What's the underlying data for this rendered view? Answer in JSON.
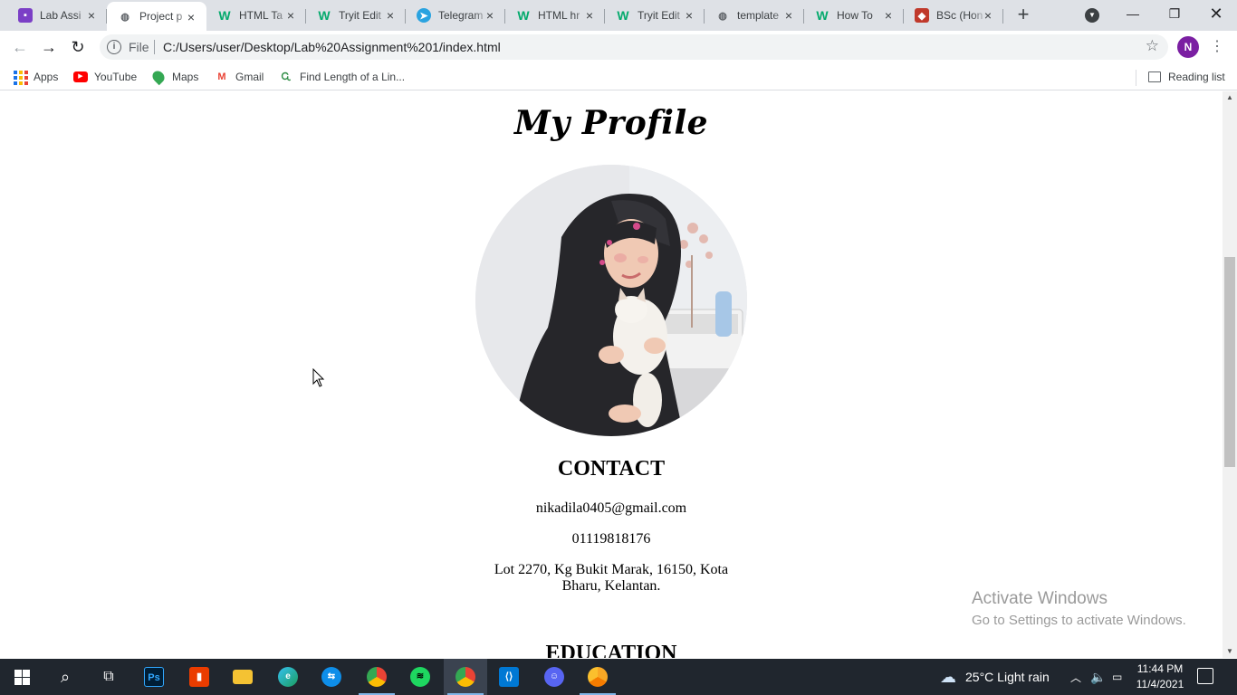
{
  "browser": {
    "tabs": [
      {
        "title": "Lab Assi",
        "icon": "classroom-icon"
      },
      {
        "title": "Project p",
        "icon": "globe-icon"
      },
      {
        "title": "HTML Ta",
        "icon": "w3schools-icon"
      },
      {
        "title": "Tryit Edit",
        "icon": "w3schools-icon"
      },
      {
        "title": "Telegram",
        "icon": "telegram-icon"
      },
      {
        "title": "HTML hr",
        "icon": "w3schools-icon"
      },
      {
        "title": "Tryit Edit",
        "icon": "w3schools-icon"
      },
      {
        "title": "template",
        "icon": "globe-icon"
      },
      {
        "title": "How To",
        "icon": "w3schools-icon"
      },
      {
        "title": "BSc (Hon",
        "icon": "university-icon"
      }
    ],
    "active_tab_index": 1,
    "address_bar": {
      "scheme": "File",
      "url": "C:/Users/user/Desktop/Lab%20Assignment%201/index.html"
    },
    "profile_initial": "N",
    "bookmarks": [
      {
        "label": "Apps",
        "icon": "apps-grid-icon"
      },
      {
        "label": "YouTube",
        "icon": "youtube-icon"
      },
      {
        "label": "Maps",
        "icon": "maps-icon"
      },
      {
        "label": "Gmail",
        "icon": "gmail-icon"
      },
      {
        "label": "Find Length of a Lin...",
        "icon": "geeksforgeeks-icon"
      }
    ],
    "reading_list_label": "Reading list"
  },
  "page": {
    "title": "My Profile",
    "profile_photo_alt": "profile photo",
    "contact": {
      "heading": "CONTACT",
      "email": "nikadila0405@gmail.com",
      "phone": "01119818176",
      "address": "Lot 2270, Kg Bukit Marak, 16150, Kota Bharu, Kelantan."
    },
    "education_heading": "EDUCATION"
  },
  "watermark": {
    "line1": "Activate Windows",
    "line2": "Go to Settings to activate Windows."
  },
  "taskbar": {
    "apps": [
      "start-icon",
      "search-icon",
      "task-view-icon",
      "photoshop-icon",
      "office-icon",
      "file-explorer-icon",
      "edge-icon",
      "teamviewer-icon",
      "chrome-icon",
      "spotify-icon",
      "chrome-profile-icon",
      "vscode-icon",
      "discord-icon",
      "chrome-canary-icon"
    ],
    "weather": "25°C  Light rain",
    "time": "11:44 PM",
    "date": "11/4/2021"
  },
  "colors": {
    "tabstrip_bg": "#dee1e6",
    "taskbar_bg": "#20262e",
    "profile_avatar": "#7b1fa2"
  }
}
